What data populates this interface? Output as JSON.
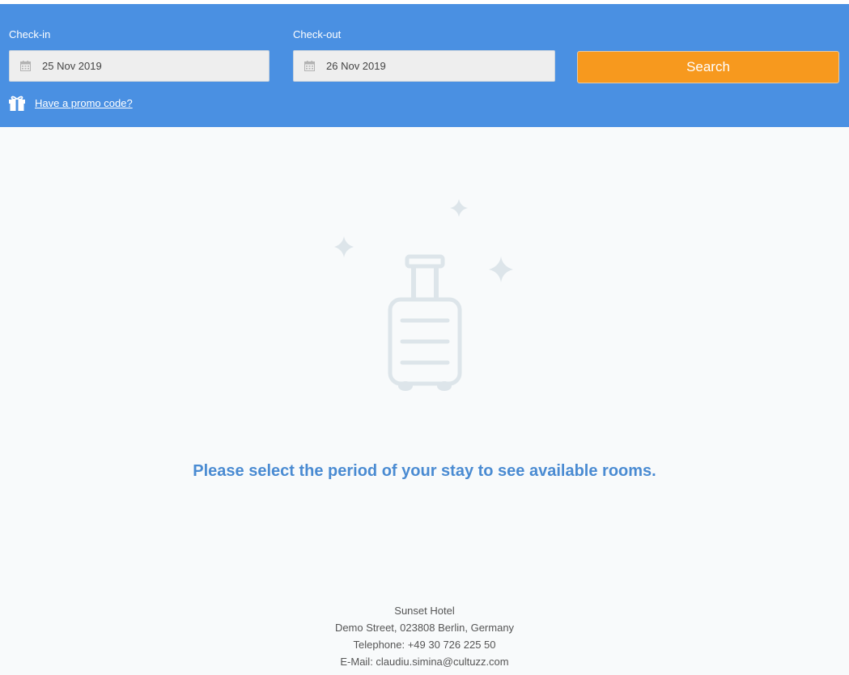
{
  "search": {
    "checkin_label": "Check-in",
    "checkin_value": "25 Nov 2019",
    "checkout_label": "Check-out",
    "checkout_value": "26 Nov 2019",
    "search_button": "Search",
    "promo_link": "Have a promo code?"
  },
  "main": {
    "message": "Please select the period of your stay to see available rooms."
  },
  "footer": {
    "hotel_name": "Sunset Hotel",
    "address": "Demo Street, 023808 Berlin, Germany",
    "telephone": "Telephone: +49 30 726 225 50",
    "email": "E-Mail: claudiu.simina@cultuzz.com"
  },
  "colors": {
    "header_bg": "#4a90e2",
    "search_button": "#f7991e",
    "message_text": "#4a8bd2",
    "illustration": "#dde5ea"
  },
  "icons": {
    "calendar": "calendar-icon",
    "gift": "gift-icon",
    "suitcase": "suitcase-icon",
    "sparkle": "sparkle-icon"
  }
}
